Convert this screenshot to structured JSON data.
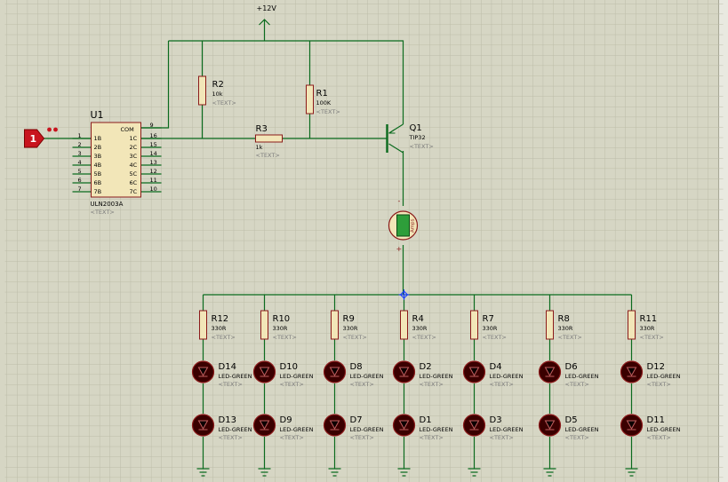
{
  "power": {
    "label": "+12V"
  },
  "input_terminal": {
    "label": "1"
  },
  "u1": {
    "ref": "U1",
    "part": "ULN2003A",
    "text_placeholder": "<TEXT>",
    "com_label": "COM",
    "left_pins": [
      {
        "num": "1",
        "name": "1B"
      },
      {
        "num": "2",
        "name": "2B"
      },
      {
        "num": "3",
        "name": "3B"
      },
      {
        "num": "4",
        "name": "4B"
      },
      {
        "num": "5",
        "name": "5B"
      },
      {
        "num": "6",
        "name": "6B"
      },
      {
        "num": "7",
        "name": "7B"
      }
    ],
    "right_pins": [
      {
        "num": "9",
        "name": "COM"
      },
      {
        "num": "16",
        "name": "1C"
      },
      {
        "num": "15",
        "name": "2C"
      },
      {
        "num": "14",
        "name": "3C"
      },
      {
        "num": "13",
        "name": "4C"
      },
      {
        "num": "12",
        "name": "5C"
      },
      {
        "num": "11",
        "name": "6C"
      },
      {
        "num": "10",
        "name": "7C"
      }
    ]
  },
  "resistors_top": [
    {
      "ref": "R2",
      "value": "10k",
      "text": "<TEXT>"
    },
    {
      "ref": "R1",
      "value": "100K",
      "text": "<TEXT>"
    },
    {
      "ref": "R3",
      "value": "1k",
      "text": "<TEXT>"
    }
  ],
  "transistor": {
    "ref": "Q1",
    "value": "TIP32",
    "text": "<TEXT>"
  },
  "ammeter": {
    "label": "Amps",
    "minus": "-",
    "plus": "+"
  },
  "resistor_row": [
    {
      "ref": "R12",
      "value": "330R",
      "text": "<TEXT>"
    },
    {
      "ref": "R10",
      "value": "330R",
      "text": "<TEXT>"
    },
    {
      "ref": "R9",
      "value": "330R",
      "text": "<TEXT>"
    },
    {
      "ref": "R4",
      "value": "330R",
      "text": "<TEXT>"
    },
    {
      "ref": "R7",
      "value": "330R",
      "text": "<TEXT>"
    },
    {
      "ref": "R8",
      "value": "330R",
      "text": "<TEXT>"
    },
    {
      "ref": "R11",
      "value": "330R",
      "text": "<TEXT>"
    }
  ],
  "led_row_top": [
    {
      "ref": "D14",
      "value": "LED-GREEN",
      "text": "<TEXT>"
    },
    {
      "ref": "D10",
      "value": "LED-GREEN",
      "text": "<TEXT>"
    },
    {
      "ref": "D8",
      "value": "LED-GREEN",
      "text": "<TEXT>"
    },
    {
      "ref": "D2",
      "value": "LED-GREEN",
      "text": "<TEXT>"
    },
    {
      "ref": "D4",
      "value": "LED-GREEN",
      "text": "<TEXT>"
    },
    {
      "ref": "D6",
      "value": "LED-GREEN",
      "text": "<TEXT>"
    },
    {
      "ref": "D12",
      "value": "LED-GREEN",
      "text": "<TEXT>"
    }
  ],
  "led_row_bottom": [
    {
      "ref": "D13",
      "value": "LED-GREEN",
      "text": "<TEXT>"
    },
    {
      "ref": "D9",
      "value": "LED-GREEN",
      "text": "<TEXT>"
    },
    {
      "ref": "D7",
      "value": "LED-GREEN",
      "text": "<TEXT>"
    },
    {
      "ref": "D1",
      "value": "LED-GREEN",
      "text": "<TEXT>"
    },
    {
      "ref": "D3",
      "value": "LED-GREEN",
      "text": "<TEXT>"
    },
    {
      "ref": "D5",
      "value": "LED-GREEN",
      "text": "<TEXT>"
    },
    {
      "ref": "D11",
      "value": "LED-GREEN",
      "text": "<TEXT>"
    }
  ],
  "colors": {
    "background": "#d6d6c4",
    "grid": "#bcbca8",
    "wire": "#0b6b1e",
    "component_body": "#f2e6b8",
    "component_outline": "#8b1a1a",
    "led_fill": "#3a0000",
    "terminal_red": "#c8141e",
    "text": "#000000",
    "text_placeholder": "#7a7a7a",
    "ammeter_display": "#2e9e3a",
    "cursor_blue": "#1a3cff"
  }
}
